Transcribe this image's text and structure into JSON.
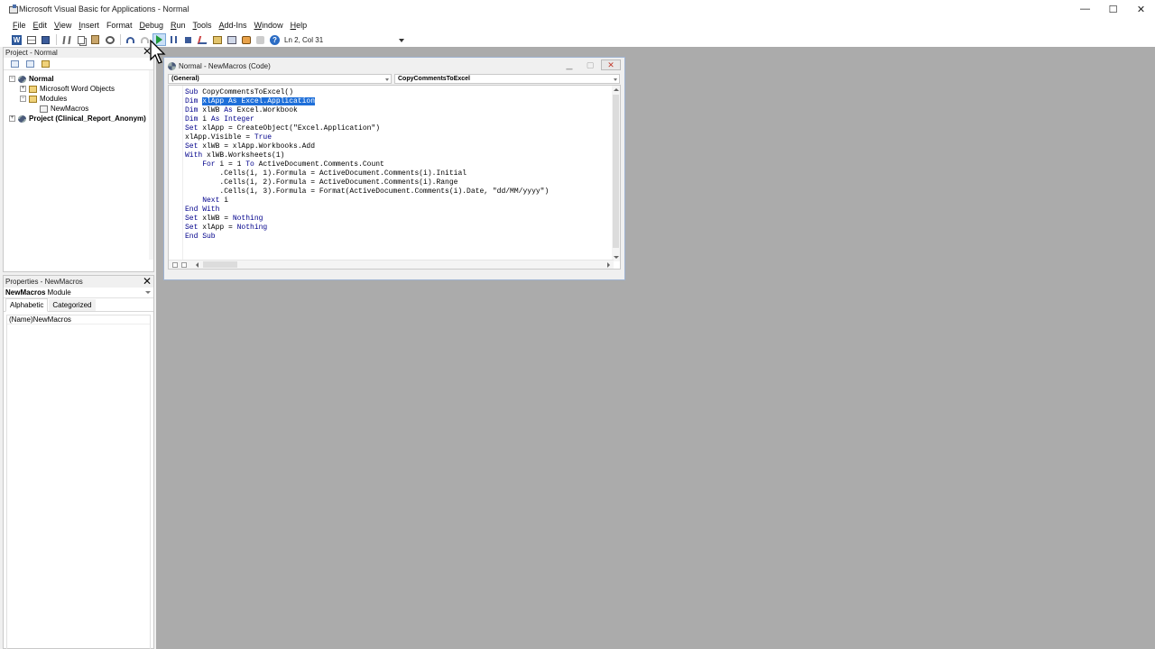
{
  "window": {
    "title": "Microsoft Visual Basic for Applications - Normal",
    "controls": [
      "—",
      "☐",
      "✕"
    ]
  },
  "menu": [
    {
      "mnemonic": "F",
      "rest": "ile"
    },
    {
      "mnemonic": "E",
      "rest": "dit"
    },
    {
      "mnemonic": "V",
      "rest": "iew"
    },
    {
      "mnemonic": "I",
      "rest": "nsert"
    },
    {
      "mnemonic": "",
      "rest": "Format"
    },
    {
      "mnemonic": "D",
      "rest": "ebug"
    },
    {
      "mnemonic": "R",
      "rest": "un"
    },
    {
      "mnemonic": "T",
      "rest": "ools"
    },
    {
      "mnemonic": "A",
      "rest": "dd-Ins"
    },
    {
      "mnemonic": "W",
      "rest": "indow"
    },
    {
      "mnemonic": "H",
      "rest": "elp"
    }
  ],
  "toolbar": {
    "word_icon_letter": "W",
    "help_icon_glyph": "?",
    "cursor_position": "Ln 2, Col 31"
  },
  "project_panel": {
    "title": "Project - Normal",
    "close_glyph": "✕",
    "tree": [
      {
        "label": "Normal",
        "bold": true,
        "toggle": "−",
        "icon": "vba",
        "level": 0
      },
      {
        "label": "Microsoft Word Objects",
        "bold": false,
        "toggle": "+",
        "icon": "folder",
        "level": 1
      },
      {
        "label": "Modules",
        "bold": false,
        "toggle": "−",
        "icon": "folder",
        "level": 1
      },
      {
        "label": "NewMacros",
        "bold": false,
        "toggle": "",
        "icon": "module",
        "level": 2
      },
      {
        "label": "Project (Clinical_Report_Anonym)",
        "bold": true,
        "toggle": "+",
        "icon": "vba",
        "level": 0
      }
    ]
  },
  "properties_panel": {
    "title": "Properties - NewMacros",
    "close_glyph": "✕",
    "object_name": "NewMacros",
    "object_type": "Module",
    "tabs": [
      "Alphabetic",
      "Categorized"
    ],
    "rows": [
      {
        "name": "(Name)",
        "value": "NewMacros"
      }
    ]
  },
  "code_window": {
    "title": "Normal - NewMacros (Code)",
    "object_combo": "(General)",
    "procedure_combo": "CopyCommentsToExcel",
    "lines": [
      [
        {
          "t": "Sub ",
          "c": "kw"
        },
        {
          "t": "CopyCommentsToExcel()",
          "c": ""
        }
      ],
      [
        {
          "t": "Dim ",
          "c": "kw"
        },
        {
          "t": "xlApp As Excel.Application",
          "c": "sel"
        }
      ],
      [
        {
          "t": "Dim ",
          "c": "kw"
        },
        {
          "t": "xlWB ",
          "c": ""
        },
        {
          "t": "As ",
          "c": "kw"
        },
        {
          "t": "Excel.Workbook",
          "c": ""
        }
      ],
      [
        {
          "t": "Dim ",
          "c": "kw"
        },
        {
          "t": "i ",
          "c": ""
        },
        {
          "t": "As Integer",
          "c": "kw"
        }
      ],
      [
        {
          "t": "Set ",
          "c": "kw"
        },
        {
          "t": "xlApp = CreateObject(\"Excel.Application\")",
          "c": ""
        }
      ],
      [
        {
          "t": "xlApp.Visible = ",
          "c": ""
        },
        {
          "t": "True",
          "c": "kw"
        }
      ],
      [
        {
          "t": "Set ",
          "c": "kw"
        },
        {
          "t": "xlWB = xlApp.Workbooks.Add",
          "c": ""
        }
      ],
      [
        {
          "t": "With ",
          "c": "kw"
        },
        {
          "t": "xlWB.Worksheets(1)",
          "c": ""
        }
      ],
      [
        {
          "t": "    ",
          "c": ""
        },
        {
          "t": "For ",
          "c": "kw"
        },
        {
          "t": "i = 1 ",
          "c": ""
        },
        {
          "t": "To ",
          "c": "kw"
        },
        {
          "t": "ActiveDocument.Comments.Count",
          "c": ""
        }
      ],
      [
        {
          "t": "        .Cells(i, 1).Formula = ActiveDocument.Comments(i).Initial",
          "c": ""
        }
      ],
      [
        {
          "t": "        .Cells(i, 2).Formula = ActiveDocument.Comments(i).Range",
          "c": ""
        }
      ],
      [
        {
          "t": "        .Cells(i, 3).Formula = Format(ActiveDocument.Comments(i).Date, \"dd/MM/yyyy\")",
          "c": ""
        }
      ],
      [
        {
          "t": "    ",
          "c": ""
        },
        {
          "t": "Next ",
          "c": "kw"
        },
        {
          "t": "i",
          "c": ""
        }
      ],
      [
        {
          "t": "End With",
          "c": "kw"
        }
      ],
      [
        {
          "t": "Set ",
          "c": "kw"
        },
        {
          "t": "xlWB = ",
          "c": ""
        },
        {
          "t": "Nothing",
          "c": "kw"
        }
      ],
      [
        {
          "t": "Set ",
          "c": "kw"
        },
        {
          "t": "xlApp = ",
          "c": ""
        },
        {
          "t": "Nothing",
          "c": "kw"
        }
      ],
      [
        {
          "t": "End Sub",
          "c": "kw"
        }
      ]
    ]
  },
  "colors": {
    "keyword": "#00008b",
    "selection": "#1e6fd9",
    "mdi_background": "#ababab"
  }
}
